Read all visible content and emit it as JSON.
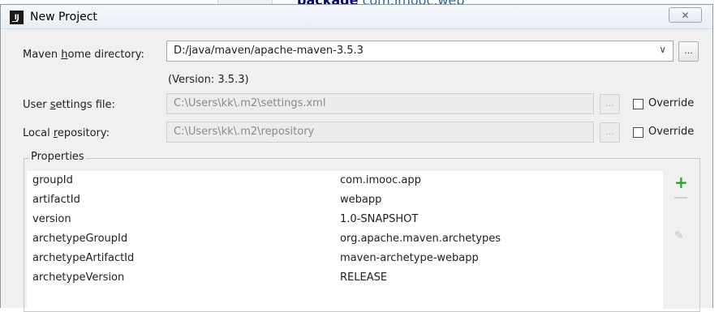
{
  "background_window": {
    "text_bold": "package",
    "text": "com.imooc.web"
  },
  "dialog": {
    "title": "New Project",
    "app_icon_label": "IJ",
    "close_glyph": "✕"
  },
  "maven_home": {
    "label_pre": "Maven ",
    "label_u": "h",
    "label_post": "ome directory:",
    "value": "D:/java/maven/apache-maven-3.5.3",
    "browse_label": "...",
    "version_text": "(Version: 3.5.3)"
  },
  "user_settings": {
    "label_pre": "User ",
    "label_u": "s",
    "label_post": "ettings file:",
    "value": "C:\\Users\\kk\\.m2\\settings.xml",
    "browse_label": "...",
    "override_label": "Override"
  },
  "local_repo": {
    "label_pre": "Local ",
    "label_u": "r",
    "label_post": "epository:",
    "value": "C:\\Users\\kk\\.m2\\repository",
    "browse_label": "...",
    "override_label": "Override"
  },
  "properties": {
    "group_title": "Properties",
    "rows": [
      {
        "key": "groupId",
        "value": "com.imooc.app"
      },
      {
        "key": "artifactId",
        "value": "webapp"
      },
      {
        "key": "version",
        "value": "1.0-SNAPSHOT"
      },
      {
        "key": "archetypeGroupId",
        "value": "org.apache.maven.archetypes"
      },
      {
        "key": "archetypeArtifactId",
        "value": "maven-archetype-webapp"
      },
      {
        "key": "archetypeVersion",
        "value": "RELEASE"
      }
    ],
    "tools": {
      "add_glyph": "+",
      "edit_glyph": "✎"
    }
  }
}
